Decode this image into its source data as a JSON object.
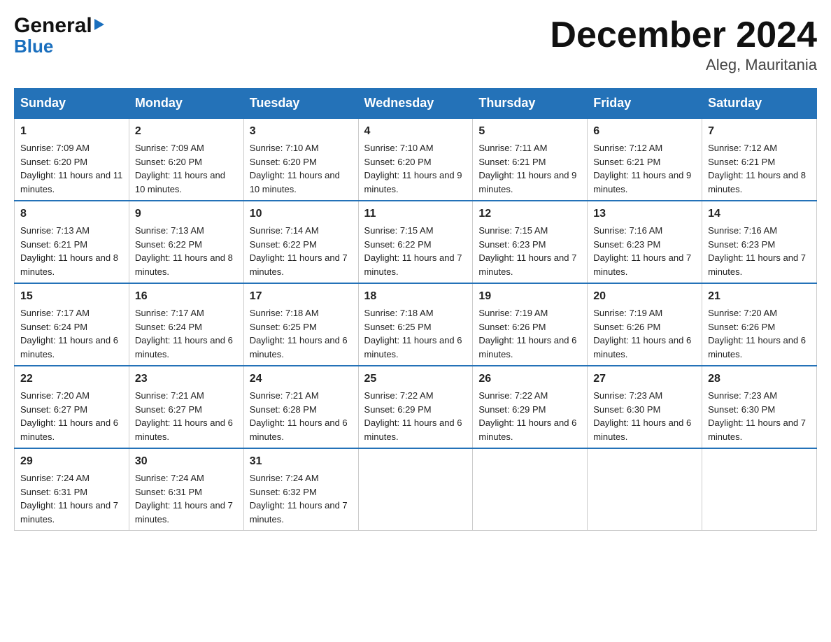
{
  "logo": {
    "name_black": "General",
    "name_blue": "Blue",
    "subtitle": "Blue"
  },
  "header": {
    "title": "December 2024",
    "subtitle": "Aleg, Mauritania"
  },
  "days_of_week": [
    "Sunday",
    "Monday",
    "Tuesday",
    "Wednesday",
    "Thursday",
    "Friday",
    "Saturday"
  ],
  "weeks": [
    [
      {
        "day": "1",
        "sunrise": "7:09 AM",
        "sunset": "6:20 PM",
        "daylight": "11 hours and 11 minutes."
      },
      {
        "day": "2",
        "sunrise": "7:09 AM",
        "sunset": "6:20 PM",
        "daylight": "11 hours and 10 minutes."
      },
      {
        "day": "3",
        "sunrise": "7:10 AM",
        "sunset": "6:20 PM",
        "daylight": "11 hours and 10 minutes."
      },
      {
        "day": "4",
        "sunrise": "7:10 AM",
        "sunset": "6:20 PM",
        "daylight": "11 hours and 9 minutes."
      },
      {
        "day": "5",
        "sunrise": "7:11 AM",
        "sunset": "6:21 PM",
        "daylight": "11 hours and 9 minutes."
      },
      {
        "day": "6",
        "sunrise": "7:12 AM",
        "sunset": "6:21 PM",
        "daylight": "11 hours and 9 minutes."
      },
      {
        "day": "7",
        "sunrise": "7:12 AM",
        "sunset": "6:21 PM",
        "daylight": "11 hours and 8 minutes."
      }
    ],
    [
      {
        "day": "8",
        "sunrise": "7:13 AM",
        "sunset": "6:21 PM",
        "daylight": "11 hours and 8 minutes."
      },
      {
        "day": "9",
        "sunrise": "7:13 AM",
        "sunset": "6:22 PM",
        "daylight": "11 hours and 8 minutes."
      },
      {
        "day": "10",
        "sunrise": "7:14 AM",
        "sunset": "6:22 PM",
        "daylight": "11 hours and 7 minutes."
      },
      {
        "day": "11",
        "sunrise": "7:15 AM",
        "sunset": "6:22 PM",
        "daylight": "11 hours and 7 minutes."
      },
      {
        "day": "12",
        "sunrise": "7:15 AM",
        "sunset": "6:23 PM",
        "daylight": "11 hours and 7 minutes."
      },
      {
        "day": "13",
        "sunrise": "7:16 AM",
        "sunset": "6:23 PM",
        "daylight": "11 hours and 7 minutes."
      },
      {
        "day": "14",
        "sunrise": "7:16 AM",
        "sunset": "6:23 PM",
        "daylight": "11 hours and 7 minutes."
      }
    ],
    [
      {
        "day": "15",
        "sunrise": "7:17 AM",
        "sunset": "6:24 PM",
        "daylight": "11 hours and 6 minutes."
      },
      {
        "day": "16",
        "sunrise": "7:17 AM",
        "sunset": "6:24 PM",
        "daylight": "11 hours and 6 minutes."
      },
      {
        "day": "17",
        "sunrise": "7:18 AM",
        "sunset": "6:25 PM",
        "daylight": "11 hours and 6 minutes."
      },
      {
        "day": "18",
        "sunrise": "7:18 AM",
        "sunset": "6:25 PM",
        "daylight": "11 hours and 6 minutes."
      },
      {
        "day": "19",
        "sunrise": "7:19 AM",
        "sunset": "6:26 PM",
        "daylight": "11 hours and 6 minutes."
      },
      {
        "day": "20",
        "sunrise": "7:19 AM",
        "sunset": "6:26 PM",
        "daylight": "11 hours and 6 minutes."
      },
      {
        "day": "21",
        "sunrise": "7:20 AM",
        "sunset": "6:26 PM",
        "daylight": "11 hours and 6 minutes."
      }
    ],
    [
      {
        "day": "22",
        "sunrise": "7:20 AM",
        "sunset": "6:27 PM",
        "daylight": "11 hours and 6 minutes."
      },
      {
        "day": "23",
        "sunrise": "7:21 AM",
        "sunset": "6:27 PM",
        "daylight": "11 hours and 6 minutes."
      },
      {
        "day": "24",
        "sunrise": "7:21 AM",
        "sunset": "6:28 PM",
        "daylight": "11 hours and 6 minutes."
      },
      {
        "day": "25",
        "sunrise": "7:22 AM",
        "sunset": "6:29 PM",
        "daylight": "11 hours and 6 minutes."
      },
      {
        "day": "26",
        "sunrise": "7:22 AM",
        "sunset": "6:29 PM",
        "daylight": "11 hours and 6 minutes."
      },
      {
        "day": "27",
        "sunrise": "7:23 AM",
        "sunset": "6:30 PM",
        "daylight": "11 hours and 6 minutes."
      },
      {
        "day": "28",
        "sunrise": "7:23 AM",
        "sunset": "6:30 PM",
        "daylight": "11 hours and 7 minutes."
      }
    ],
    [
      {
        "day": "29",
        "sunrise": "7:24 AM",
        "sunset": "6:31 PM",
        "daylight": "11 hours and 7 minutes."
      },
      {
        "day": "30",
        "sunrise": "7:24 AM",
        "sunset": "6:31 PM",
        "daylight": "11 hours and 7 minutes."
      },
      {
        "day": "31",
        "sunrise": "7:24 AM",
        "sunset": "6:32 PM",
        "daylight": "11 hours and 7 minutes."
      },
      null,
      null,
      null,
      null
    ]
  ]
}
